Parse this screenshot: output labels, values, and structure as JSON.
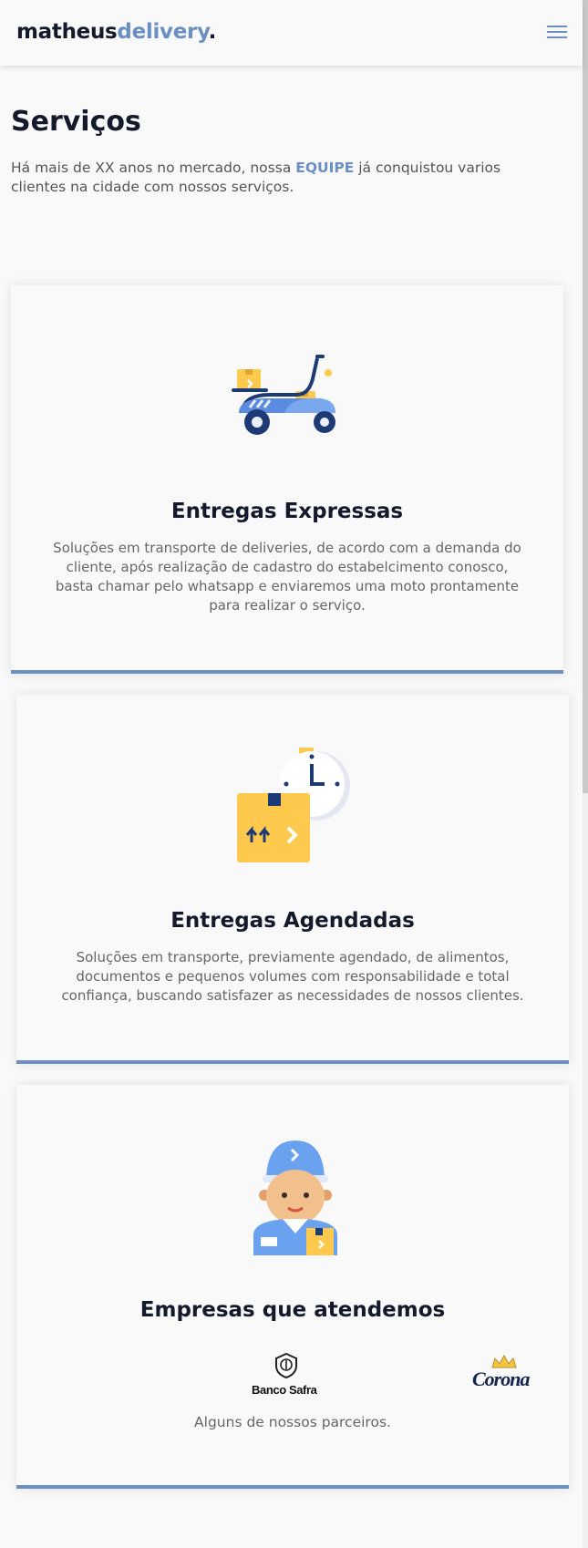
{
  "header": {
    "logo_part1": "matheus",
    "logo_part2": "delivery",
    "logo_part3": ".",
    "menu_icon": "hamburger-menu-icon"
  },
  "services": {
    "title": "Serviços",
    "intro_before": "Há mais de XX anos no mercado, nossa ",
    "intro_highlight": "EQUIPE",
    "intro_after": " já conquistou varios clientes na cidade com nossos serviços."
  },
  "cards": [
    {
      "icon": "scooter-delivery-icon",
      "title": "Entregas Expressas",
      "text": "Soluções em transporte de deliveries, de acordo com a demanda do cliente, após realização de cadastro do estabelcimento conosco, basta chamar pelo whatsapp e enviaremos uma moto prontamente para realizar o serviço."
    },
    {
      "icon": "scheduled-package-clock-icon",
      "title": "Entregas Agendadas",
      "text": "Soluções em transporte, previamente agendado, de alimentos, documentos e pequenos volumes com responsabilidade e total confiança, buscando satisfazer as necessidades de nossos clientes."
    },
    {
      "icon": "delivery-man-icon",
      "title": "Empresas que atendemos",
      "partners": [
        {
          "name": "Banco Safra",
          "icon": "banco-safra-logo"
        },
        {
          "name": "Corona",
          "icon": "corona-logo"
        }
      ],
      "text": "Alguns de nossos parceiros."
    }
  ],
  "colors": {
    "accent": "#6b8fc3",
    "dark": "#141a2b",
    "background": "#f9f9f9"
  }
}
